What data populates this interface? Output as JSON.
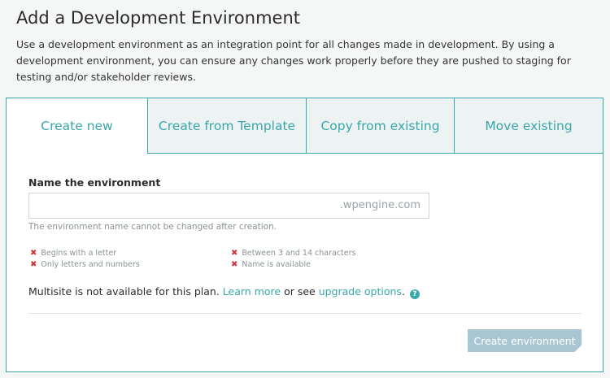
{
  "header": {
    "title": "Add a Development Environment",
    "description": "Use a development environment as an integration point for all changes made in development. By using a development environment, you can ensure any changes work properly before they are pushed to staging for testing and/or stakeholder reviews."
  },
  "tabs": [
    {
      "label": "Create new",
      "active": true
    },
    {
      "label": "Create from Template",
      "active": false
    },
    {
      "label": "Copy from existing",
      "active": false
    },
    {
      "label": "Move existing",
      "active": false
    }
  ],
  "form": {
    "name_label": "Name the environment",
    "name_value": "",
    "name_placeholder": "",
    "domain_suffix": ".wpengine.com",
    "hint": "The environment name cannot be changed after creation.",
    "rules": [
      {
        "text": "Begins with a letter",
        "status": "fail"
      },
      {
        "text": "Only letters and numbers",
        "status": "fail"
      },
      {
        "text": "Between 3 and 14 characters",
        "status": "fail"
      },
      {
        "text": "Name is available",
        "status": "fail"
      }
    ],
    "rule_fail_glyph": "✖"
  },
  "multisite": {
    "prefix": "Multisite is not available for this plan. ",
    "learn_more": "Learn more",
    "middle": " or see ",
    "upgrade": "upgrade options",
    "suffix": ".",
    "help_glyph": "?"
  },
  "actions": {
    "create_label": "Create environment",
    "create_disabled": true
  },
  "colors": {
    "accent": "#3aa7aa",
    "error": "#d0343a",
    "button_disabled": "#a9c6d3"
  }
}
